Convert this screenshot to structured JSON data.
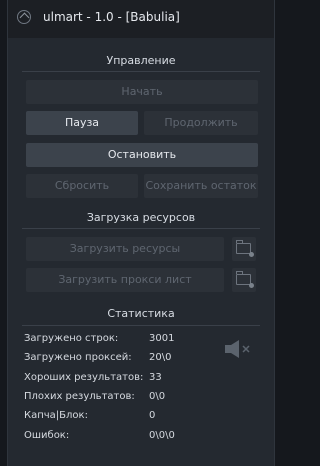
{
  "window": {
    "title": "ulmart - 1.0 - [Babulia]"
  },
  "control": {
    "header": "Управление",
    "start_label": "Начать",
    "pause_label": "Пауза",
    "continue_label": "Продолжить",
    "stop_label": "Остановить",
    "reset_label": "Сбросить",
    "save_rest_label": "Сохранить остаток"
  },
  "resources": {
    "header": "Загрузка ресурсов",
    "load_resources_label": "Загрузить ресурсы",
    "load_proxy_label": "Загрузить прокси лист"
  },
  "stats": {
    "header": "Статистика",
    "rows": [
      {
        "label": "Загружено строк:",
        "value": "3001"
      },
      {
        "label": "Загружено проксей:",
        "value": "20\\0"
      },
      {
        "label": "Хороших результатов:",
        "value": "33"
      },
      {
        "label": "Плохих результатов:",
        "value": "0\\0"
      },
      {
        "label": "Капча|Блок:",
        "value": "0"
      },
      {
        "label": "Ошибок:",
        "value": "0\\0\\0"
      }
    ]
  },
  "icons": {
    "app": "app-icon",
    "folder": "folder-icon",
    "speaker_muted": "speaker-muted-icon"
  },
  "colors": {
    "background": "#15181d",
    "panel": "#242930",
    "titlebar": "#1c1f24",
    "button_disabled": "#2c3138",
    "button_active": "#3c434c",
    "text": "#d6dae0",
    "text_disabled": "#5f6670"
  }
}
